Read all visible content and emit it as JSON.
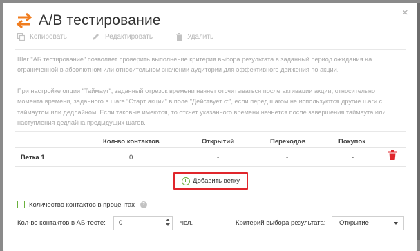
{
  "modal": {
    "title": "А/В тестирование",
    "close_glyph": "×"
  },
  "toolbar": {
    "copy_label": "Копировать",
    "edit_label": "Редактировать",
    "delete_label": "Удалить"
  },
  "description": {
    "p1_line1": "Шаг \"АБ тестирование\" позволяет проверить выполнение критерия выбора результата в заданный период ожидания на",
    "p1_line2": "ограниченной в абсолютном или относительном значении аудитории для эффективного движения по акции.",
    "p2_line1": "При настройке опции \"Таймаут\", заданный отрезок времени начнет отсчитываться после активации акции, относительно",
    "p2_line2": "момента времени, заданного в шаге \"Старт акции\" в поле \"Действует с:\", если перед шагом не используются другие шаги с",
    "p2_line3": "таймаутом или дедлайном. Если таковые имеются, то отсчет указанного времени начнется после завершения таймаута или",
    "p2_line4": "наступления дедлайна предыдущих шагов."
  },
  "table": {
    "headers": [
      "Кол-во контактов",
      "Открытий",
      "Переходов",
      "Покупок"
    ],
    "rows": [
      {
        "name": "Ветка 1",
        "contacts": "0",
        "opens": "-",
        "clicks": "-",
        "purchases": "-"
      }
    ]
  },
  "add_branch_label": "Добавить ветку",
  "settings": {
    "percent_checkbox_label": "Количество контактов в процентах",
    "percent_checked": false,
    "help_glyph": "?",
    "contacts_label": "Кол-во контактов в АБ-тесте:",
    "contacts_value": "0",
    "unit_label": "чел.",
    "criterion_label": "Критерий выбора результата:",
    "criterion_value": "Открытие"
  },
  "colors": {
    "accent_orange": "#f07d1f",
    "danger_red": "#e0262c",
    "success_green": "#6ab03d"
  }
}
